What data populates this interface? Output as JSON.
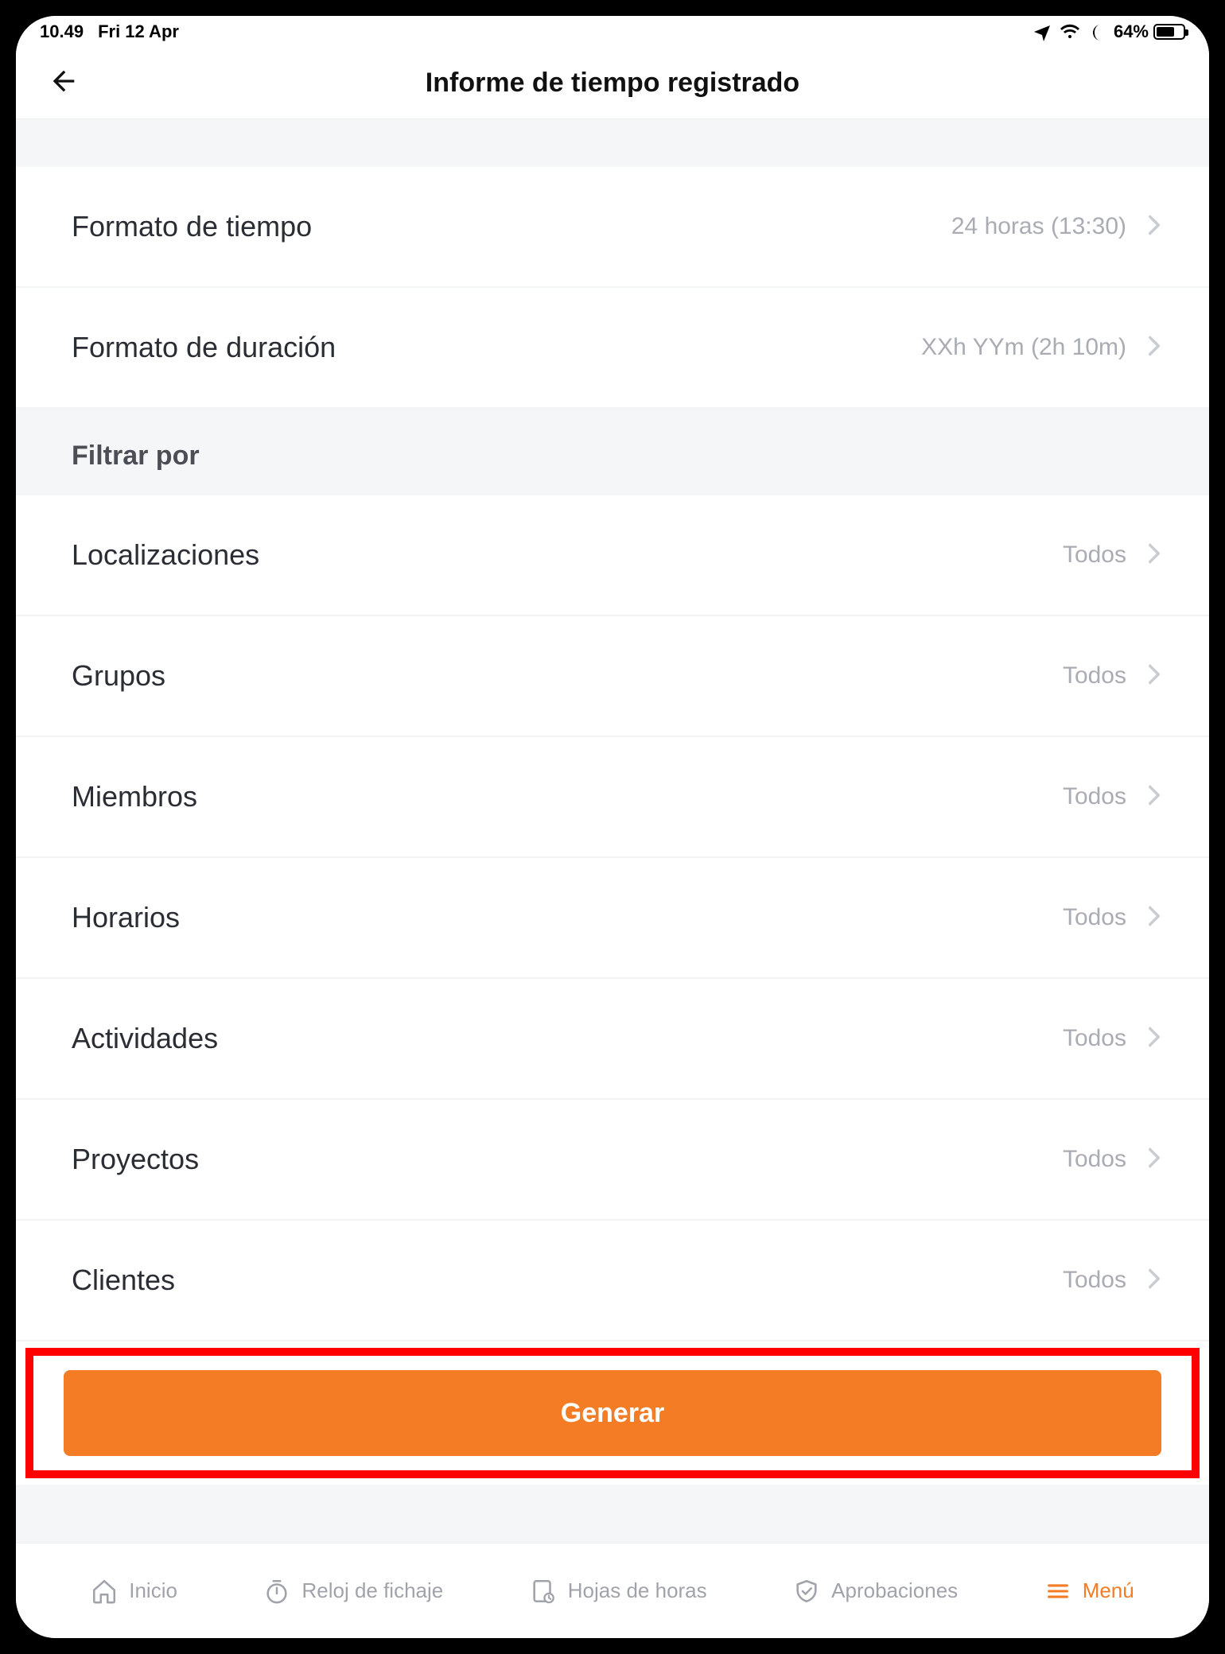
{
  "status": {
    "time": "10.49",
    "date": "Fri 12 Apr",
    "battery_pct": "64%"
  },
  "header": {
    "title": "Informe de tiempo registrado"
  },
  "format": {
    "time": {
      "label": "Formato de tiempo",
      "value": "24 horas (13:30)"
    },
    "duration": {
      "label": "Formato de duración",
      "value": "XXh YYm (2h 10m)"
    }
  },
  "filters": {
    "section_title": "Filtrar por",
    "locations": {
      "label": "Localizaciones",
      "value": "Todos"
    },
    "groups": {
      "label": "Grupos",
      "value": "Todos"
    },
    "members": {
      "label": "Miembros",
      "value": "Todos"
    },
    "schedules": {
      "label": "Horarios",
      "value": "Todos"
    },
    "activities": {
      "label": "Actividades",
      "value": "Todos"
    },
    "projects": {
      "label": "Proyectos",
      "value": "Todos"
    },
    "clients": {
      "label": "Clientes",
      "value": "Todos"
    }
  },
  "actions": {
    "generate_label": "Generar"
  },
  "nav": {
    "home": "Inicio",
    "timeclock": "Reloj de fichaje",
    "timesheets": "Hojas de horas",
    "approvals": "Aprobaciones",
    "menu": "Menú"
  },
  "colors": {
    "accent": "#f47c24",
    "highlight": "#ff0000"
  }
}
